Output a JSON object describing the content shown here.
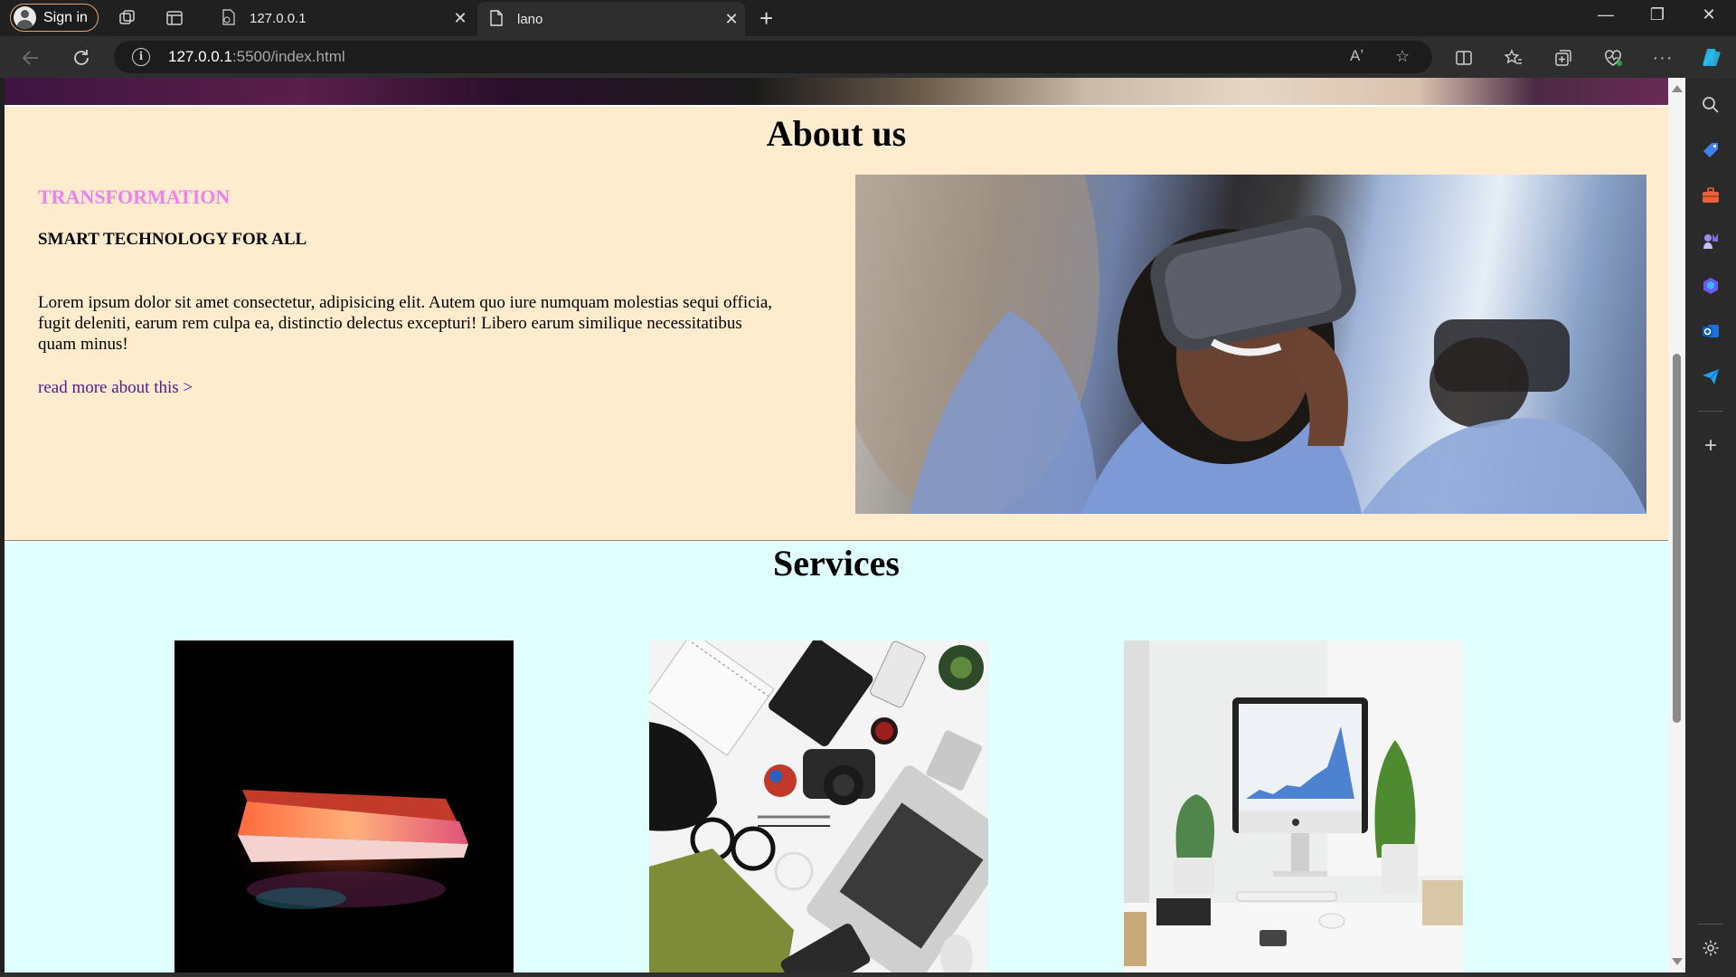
{
  "browser": {
    "signin_label": "Sign in",
    "tabs": [
      {
        "title": "127.0.0.1",
        "active": false
      },
      {
        "title": "lano",
        "active": true
      }
    ],
    "url_host": "127.0.0.1",
    "url_path": ":5500/index.html",
    "read_aloud_label": "Aʼ"
  },
  "page": {
    "about": {
      "heading": "About us",
      "kicker": "TRANSFORMATION",
      "subheading": "SMART TECHNOLOGY FOR ALL",
      "body": "Lorem ipsum dolor sit amet consectetur, adipisicing elit. Autem quo iure numquam molestias sequi officia, fugit deleniti, earum rem culpa ea, distinctio delectus excepturi! Libero earum similique necessitatibus quam minus!",
      "link": "read more about this >"
    },
    "services": {
      "heading": "Services"
    }
  },
  "colors": {
    "about_bg": "#ffebcd",
    "services_bg": "#e0ffff",
    "kicker": "#ee82ee",
    "link": "#551a8b"
  }
}
